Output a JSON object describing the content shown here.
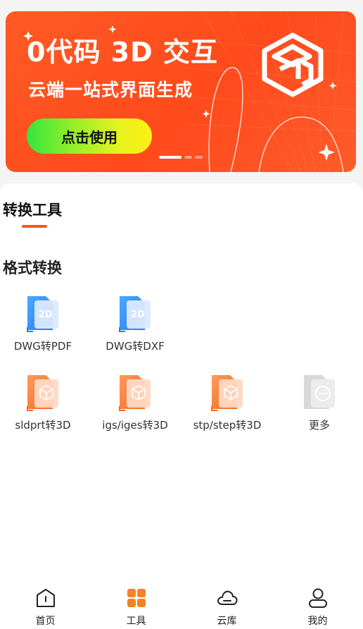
{
  "banner": {
    "title": "0代码 3D 交互",
    "subtitle": "云端一站式界面生成",
    "cta_label": "点击使用",
    "colors": {
      "background": "#ff4f1f",
      "cta_start": "#35e53b",
      "cta_end": "#ffef15"
    }
  },
  "tabs": {
    "active_label": "转换工具",
    "accent": "#f05a1a"
  },
  "section": {
    "title": "格式转换"
  },
  "tools": [
    {
      "label": "DWG转PDF",
      "icon": "2d-file-icon",
      "color": "blue"
    },
    {
      "label": "DWG转DXF",
      "icon": "2d-file-icon",
      "color": "blue"
    },
    {
      "label": "sldprt转3D",
      "icon": "3d-cube-file-icon",
      "color": "orange"
    },
    {
      "label": "igs/iges转3D",
      "icon": "3d-cube-file-icon",
      "color": "orange"
    },
    {
      "label": "stp/step转3D",
      "icon": "3d-cube-file-icon",
      "color": "orange"
    },
    {
      "label": "更多",
      "icon": "more-file-icon",
      "color": "gray"
    }
  ],
  "icon_text": {
    "two_d": "2D"
  },
  "nav": [
    {
      "label": "首页",
      "icon": "home-icon",
      "active": false
    },
    {
      "label": "工具",
      "icon": "tools-grid-icon",
      "active": true
    },
    {
      "label": "云库",
      "icon": "cloud-icon",
      "active": false
    },
    {
      "label": "我的",
      "icon": "user-icon",
      "active": false
    }
  ]
}
